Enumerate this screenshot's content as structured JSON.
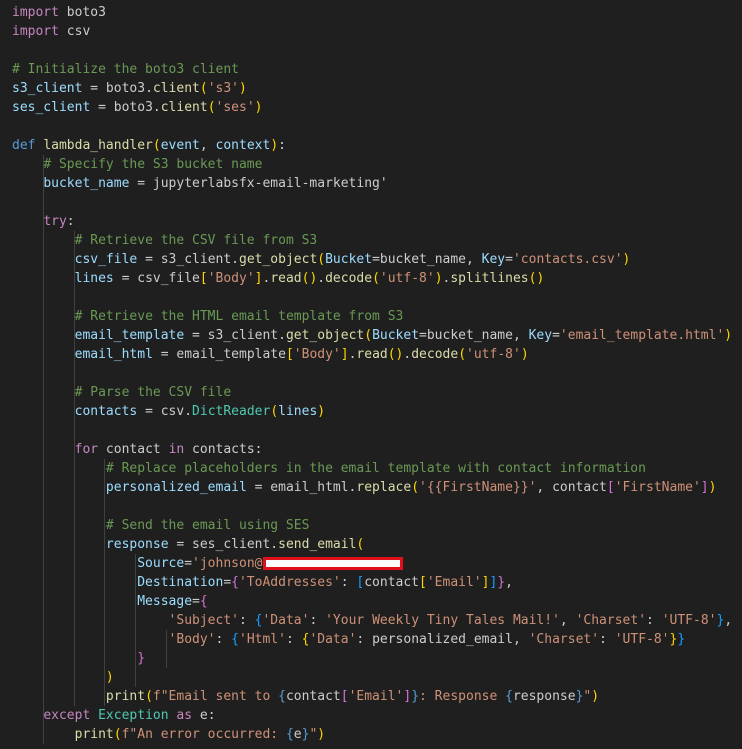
{
  "editor": {
    "redaction_box": "redacted-email-domain",
    "lines": [
      [
        [
          "import",
          "ctl"
        ],
        [
          " boto3",
          "def"
        ]
      ],
      [
        [
          "import",
          "ctl"
        ],
        [
          " csv",
          "def"
        ]
      ],
      [],
      [
        [
          "# Initialize the boto3 client",
          "com"
        ]
      ],
      [
        [
          "s3_client",
          "var"
        ],
        [
          " = boto3.",
          "def"
        ],
        [
          "client",
          "fn"
        ],
        [
          "(",
          "br1"
        ],
        [
          "'s3'",
          "str"
        ],
        [
          ")",
          "br1"
        ]
      ],
      [
        [
          "ses_client",
          "var"
        ],
        [
          " = boto3.",
          "def"
        ],
        [
          "client",
          "fn"
        ],
        [
          "(",
          "br1"
        ],
        [
          "'ses'",
          "str"
        ],
        [
          ")",
          "br1"
        ]
      ],
      [],
      [
        [
          "def",
          "kw"
        ],
        [
          " ",
          "def"
        ],
        [
          "lambda_handler",
          "fn"
        ],
        [
          "(",
          "br1"
        ],
        [
          "event",
          "var"
        ],
        [
          ", ",
          "def"
        ],
        [
          "context",
          "var"
        ],
        [
          ")",
          "br1"
        ],
        [
          ":",
          "def"
        ]
      ],
      [
        [
          "    ",
          "def"
        ],
        [
          "# Specify the S3 bucket name",
          "com"
        ]
      ],
      [
        [
          "    ",
          "def"
        ],
        [
          "bucket_name",
          "var"
        ],
        [
          " = jupyterlabsfx-email-marketing'",
          "def"
        ]
      ],
      [],
      [
        [
          "    ",
          "def"
        ],
        [
          "try",
          "ctl"
        ],
        [
          ":",
          "def"
        ]
      ],
      [
        [
          "        ",
          "def"
        ],
        [
          "# Retrieve the CSV file from S3",
          "com"
        ]
      ],
      [
        [
          "        ",
          "def"
        ],
        [
          "csv_file",
          "var"
        ],
        [
          " = s3_client.",
          "def"
        ],
        [
          "get_object",
          "fn"
        ],
        [
          "(",
          "br1"
        ],
        [
          "Bucket",
          "var"
        ],
        [
          "=bucket_name, ",
          "def"
        ],
        [
          "Key",
          "var"
        ],
        [
          "=",
          "def"
        ],
        [
          "'contacts.csv'",
          "str"
        ],
        [
          ")",
          "br1"
        ]
      ],
      [
        [
          "        ",
          "def"
        ],
        [
          "lines",
          "var"
        ],
        [
          " = csv_file",
          "def"
        ],
        [
          "[",
          "br1"
        ],
        [
          "'Body'",
          "str"
        ],
        [
          "]",
          "br1"
        ],
        [
          ".",
          "def"
        ],
        [
          "read",
          "fn"
        ],
        [
          "()",
          "br1"
        ],
        [
          ".",
          "def"
        ],
        [
          "decode",
          "fn"
        ],
        [
          "(",
          "br1"
        ],
        [
          "'utf-8'",
          "str"
        ],
        [
          ")",
          "br1"
        ],
        [
          ".",
          "def"
        ],
        [
          "splitlines",
          "fn"
        ],
        [
          "()",
          "br1"
        ]
      ],
      [],
      [
        [
          "        ",
          "def"
        ],
        [
          "# Retrieve the HTML email template from S3",
          "com"
        ]
      ],
      [
        [
          "        ",
          "def"
        ],
        [
          "email_template",
          "var"
        ],
        [
          " = s3_client.",
          "def"
        ],
        [
          "get_object",
          "fn"
        ],
        [
          "(",
          "br1"
        ],
        [
          "Bucket",
          "var"
        ],
        [
          "=bucket_name, ",
          "def"
        ],
        [
          "Key",
          "var"
        ],
        [
          "=",
          "def"
        ],
        [
          "'email_template.html'",
          "str"
        ],
        [
          ")",
          "br1"
        ]
      ],
      [
        [
          "        ",
          "def"
        ],
        [
          "email_html",
          "var"
        ],
        [
          " = email_template",
          "def"
        ],
        [
          "[",
          "br1"
        ],
        [
          "'Body'",
          "str"
        ],
        [
          "]",
          "br1"
        ],
        [
          ".",
          "def"
        ],
        [
          "read",
          "fn"
        ],
        [
          "()",
          "br1"
        ],
        [
          ".",
          "def"
        ],
        [
          "decode",
          "fn"
        ],
        [
          "(",
          "br1"
        ],
        [
          "'utf-8'",
          "str"
        ],
        [
          ")",
          "br1"
        ]
      ],
      [],
      [
        [
          "        ",
          "def"
        ],
        [
          "# Parse the CSV file",
          "com"
        ]
      ],
      [
        [
          "        ",
          "def"
        ],
        [
          "contacts",
          "var"
        ],
        [
          " = csv.",
          "def"
        ],
        [
          "DictReader",
          "cls"
        ],
        [
          "(",
          "br1"
        ],
        [
          "lines",
          "var"
        ],
        [
          ")",
          "br1"
        ]
      ],
      [],
      [
        [
          "        ",
          "def"
        ],
        [
          "for",
          "ctl"
        ],
        [
          " contact ",
          "def"
        ],
        [
          "in",
          "ctl"
        ],
        [
          " contacts:",
          "def"
        ]
      ],
      [
        [
          "            ",
          "def"
        ],
        [
          "# Replace placeholders in the email template with contact information",
          "com"
        ]
      ],
      [
        [
          "            ",
          "def"
        ],
        [
          "personalized_email",
          "var"
        ],
        [
          " = email_html.",
          "def"
        ],
        [
          "replace",
          "fn"
        ],
        [
          "(",
          "br1"
        ],
        [
          "'{{FirstName}}'",
          "str"
        ],
        [
          ", contact",
          "def"
        ],
        [
          "[",
          "br2"
        ],
        [
          "'FirstName'",
          "str"
        ],
        [
          "]",
          "br2"
        ],
        [
          ")",
          "br1"
        ]
      ],
      [],
      [
        [
          "            ",
          "def"
        ],
        [
          "# Send the email using SES",
          "com"
        ]
      ],
      [
        [
          "            ",
          "def"
        ],
        [
          "response",
          "var"
        ],
        [
          " = ses_client.",
          "def"
        ],
        [
          "send_email",
          "fn"
        ],
        [
          "(",
          "br1"
        ]
      ],
      [
        [
          "                ",
          "def"
        ],
        [
          "Source",
          "var"
        ],
        [
          "=",
          "def"
        ],
        [
          "'johnson@",
          "str"
        ],
        [
          "@REDACT",
          "def"
        ]
      ],
      [
        [
          "                ",
          "def"
        ],
        [
          "Destination",
          "var"
        ],
        [
          "=",
          "def"
        ],
        [
          "{",
          "br2"
        ],
        [
          "'ToAddresses'",
          "str"
        ],
        [
          ": ",
          "def"
        ],
        [
          "[",
          "br3"
        ],
        [
          "contact",
          "def"
        ],
        [
          "[",
          "br1"
        ],
        [
          "'Email'",
          "str"
        ],
        [
          "]",
          "br1"
        ],
        [
          "]",
          "br3"
        ],
        [
          "}",
          "br2"
        ],
        [
          ",",
          "def"
        ]
      ],
      [
        [
          "                ",
          "def"
        ],
        [
          "Message",
          "var"
        ],
        [
          "=",
          "def"
        ],
        [
          "{",
          "br2"
        ]
      ],
      [
        [
          "                    ",
          "def"
        ],
        [
          "'Subject'",
          "str"
        ],
        [
          ": ",
          "def"
        ],
        [
          "{",
          "br3"
        ],
        [
          "'Data'",
          "str"
        ],
        [
          ": ",
          "def"
        ],
        [
          "'Your Weekly Tiny Tales Mail!'",
          "str"
        ],
        [
          ", ",
          "def"
        ],
        [
          "'Charset'",
          "str"
        ],
        [
          ": ",
          "def"
        ],
        [
          "'UTF-8'",
          "str"
        ],
        [
          "}",
          "br3"
        ],
        [
          ",",
          "def"
        ]
      ],
      [
        [
          "                    ",
          "def"
        ],
        [
          "'Body'",
          "str"
        ],
        [
          ": ",
          "def"
        ],
        [
          "{",
          "br3"
        ],
        [
          "'Html'",
          "str"
        ],
        [
          ": ",
          "def"
        ],
        [
          "{",
          "br1"
        ],
        [
          "'Data'",
          "str"
        ],
        [
          ": personalized_email, ",
          "def"
        ],
        [
          "'Charset'",
          "str"
        ],
        [
          ": ",
          "def"
        ],
        [
          "'UTF-8'",
          "str"
        ],
        [
          "}",
          "br1"
        ],
        [
          "}",
          "br3"
        ]
      ],
      [
        [
          "                ",
          "def"
        ],
        [
          "}",
          "br2"
        ]
      ],
      [
        [
          "            ",
          "def"
        ],
        [
          ")",
          "br1"
        ]
      ],
      [
        [
          "            ",
          "def"
        ],
        [
          "print",
          "fn"
        ],
        [
          "(",
          "br1"
        ],
        [
          "f\"Email sent to ",
          "str"
        ],
        [
          "{",
          "kw"
        ],
        [
          "contact",
          "def"
        ],
        [
          "[",
          "br2"
        ],
        [
          "'Email'",
          "str"
        ],
        [
          "]",
          "br2"
        ],
        [
          "}",
          "kw"
        ],
        [
          ": Response ",
          "str"
        ],
        [
          "{",
          "kw"
        ],
        [
          "response",
          "def"
        ],
        [
          "}",
          "kw"
        ],
        [
          "\"",
          "str"
        ],
        [
          ")",
          "br1"
        ]
      ],
      [
        [
          "    ",
          "def"
        ],
        [
          "except",
          "ctl"
        ],
        [
          " ",
          "def"
        ],
        [
          "Exception",
          "cls"
        ],
        [
          " ",
          "def"
        ],
        [
          "as",
          "ctl"
        ],
        [
          " e:",
          "def"
        ]
      ],
      [
        [
          "        ",
          "def"
        ],
        [
          "print",
          "fn"
        ],
        [
          "(",
          "br1"
        ],
        [
          "f\"An error occurred: ",
          "str"
        ],
        [
          "{",
          "kw"
        ],
        [
          "e",
          "def"
        ],
        [
          "}",
          "kw"
        ],
        [
          "\"",
          "str"
        ],
        [
          ")",
          "br1"
        ]
      ]
    ]
  }
}
